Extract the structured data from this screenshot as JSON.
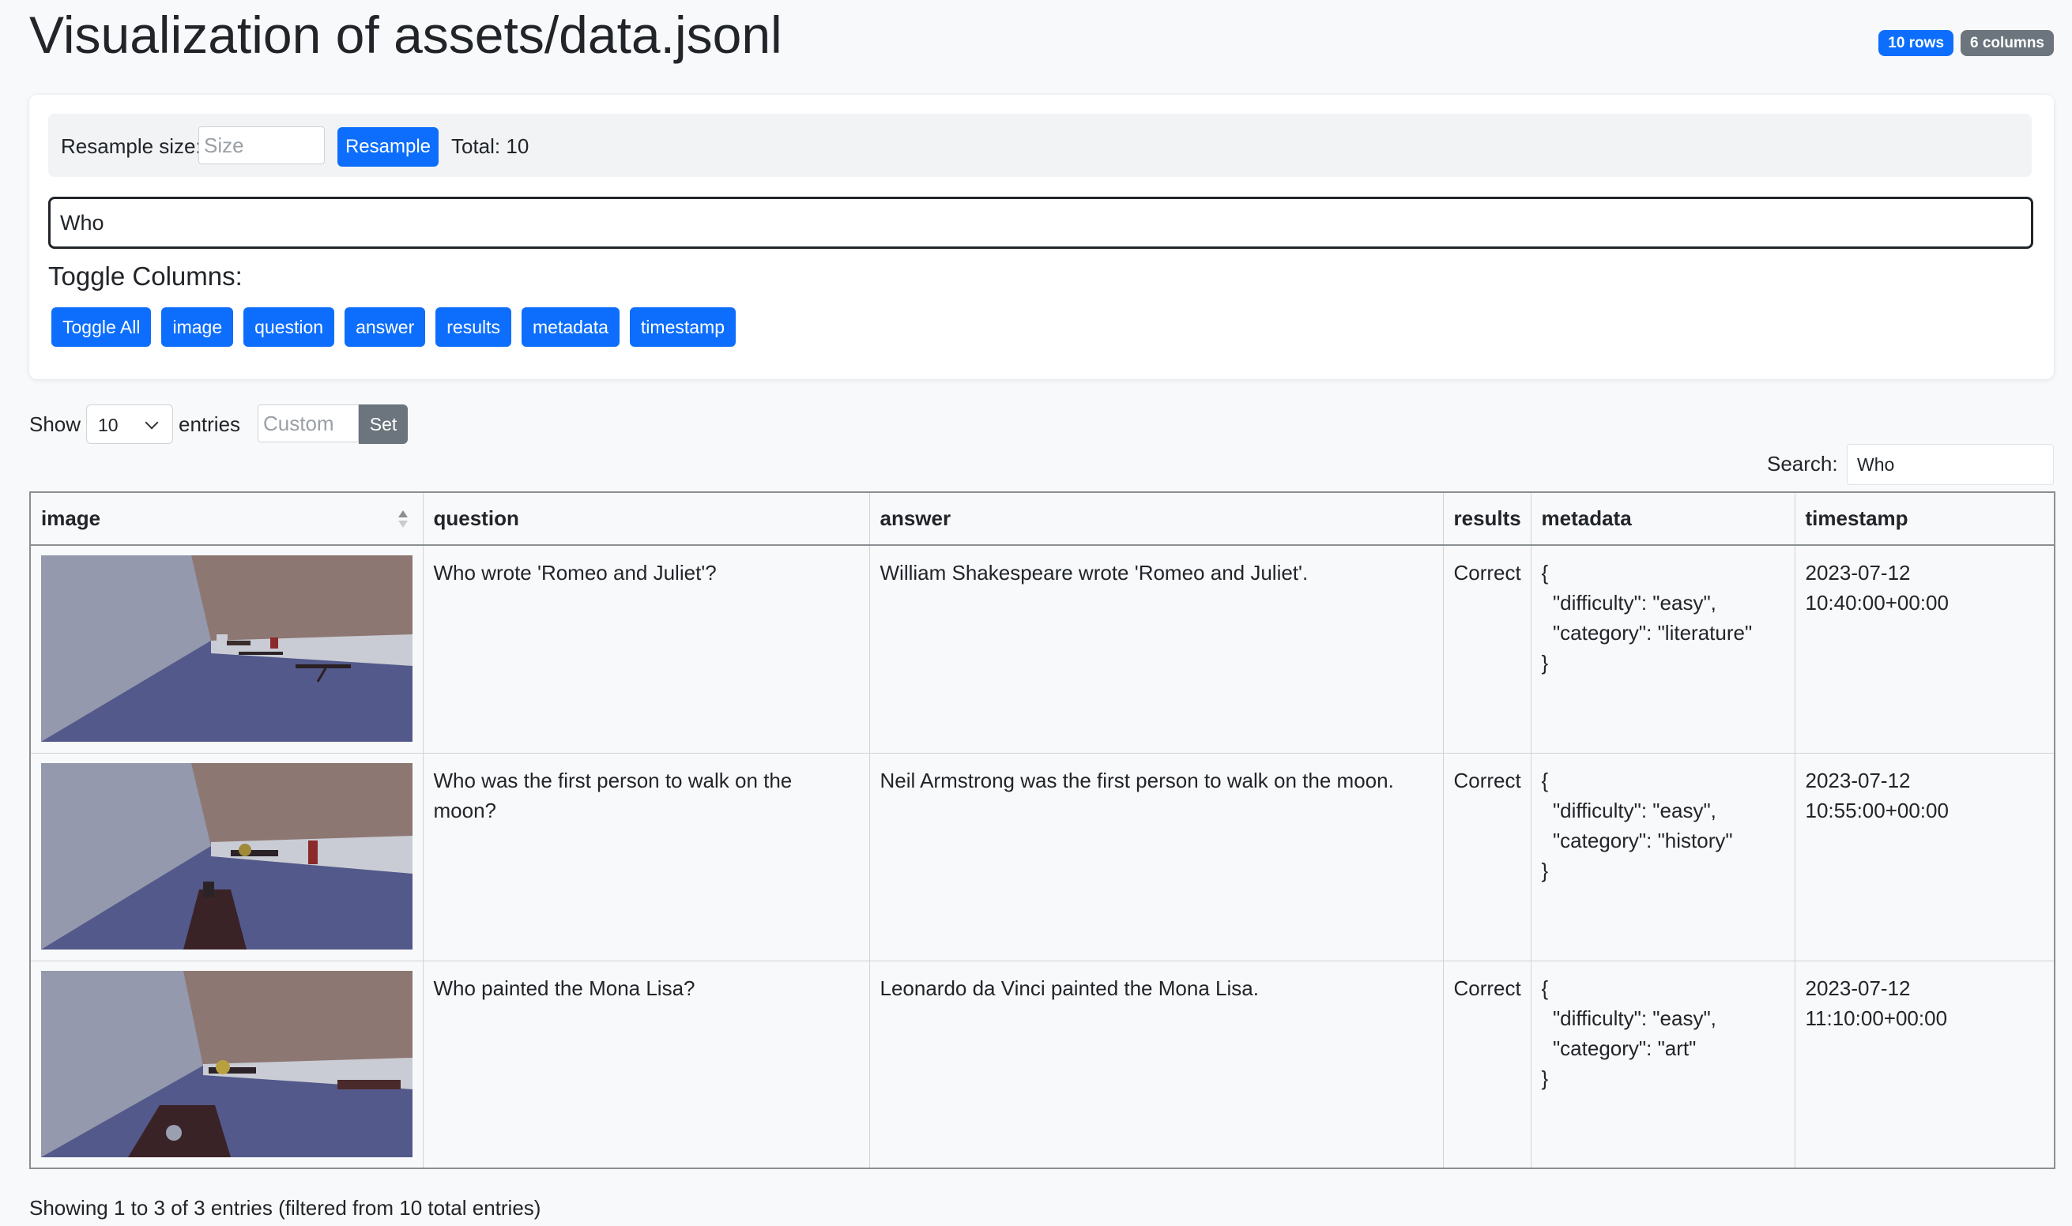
{
  "page": {
    "title": "Visualization of assets/data.jsonl",
    "badges": {
      "rows": "10 rows",
      "columns": "6 columns"
    }
  },
  "colors": {
    "primary": "#0d6efd",
    "secondary": "#6c757d",
    "background": "#f8f9fa"
  },
  "controls": {
    "resample_label": "Resample size:",
    "resample_placeholder": "Size",
    "resample_button": "Resample",
    "total": "Total: 10",
    "search_value": "Who",
    "toggle_title": "Toggle Columns:",
    "toggles": [
      "Toggle All",
      "image",
      "question",
      "answer",
      "results",
      "metadata",
      "timestamp"
    ]
  },
  "table_controls": {
    "show_label": "Show",
    "show_value": "10",
    "entries_label": "entries",
    "custom_placeholder": "Custom",
    "set_button": "Set",
    "search_label": "Search:",
    "search_value": "Who"
  },
  "table": {
    "columns": [
      "image",
      "question",
      "answer",
      "results",
      "metadata",
      "timestamp"
    ],
    "sort_icon": "sort-icon",
    "rows": [
      {
        "question": "Who wrote 'Romeo and Juliet'?",
        "answer": "William Shakespeare wrote 'Romeo and Juliet'.",
        "results": "Correct",
        "metadata": "{\n  \"difficulty\": \"easy\",\n  \"category\": \"literature\"\n}",
        "timestamp": "2023-07-12\n10:40:00+00:00"
      },
      {
        "question": "Who was the first person to walk on the moon?",
        "answer": "Neil Armstrong was the first person to walk on the moon.",
        "results": "Correct",
        "metadata": "{\n  \"difficulty\": \"easy\",\n  \"category\": \"history\"\n}",
        "timestamp": "2023-07-12\n10:55:00+00:00"
      },
      {
        "question": "Who painted the Mona Lisa?",
        "answer": "Leonardo da Vinci painted the Mona Lisa.",
        "results": "Correct",
        "metadata": "{\n  \"difficulty\": \"easy\",\n  \"category\": \"art\"\n}",
        "timestamp": "2023-07-12\n11:10:00+00:00"
      }
    ]
  },
  "footer": {
    "info": "Showing 1 to 3 of 3 entries (filtered from 10 total entries)"
  }
}
